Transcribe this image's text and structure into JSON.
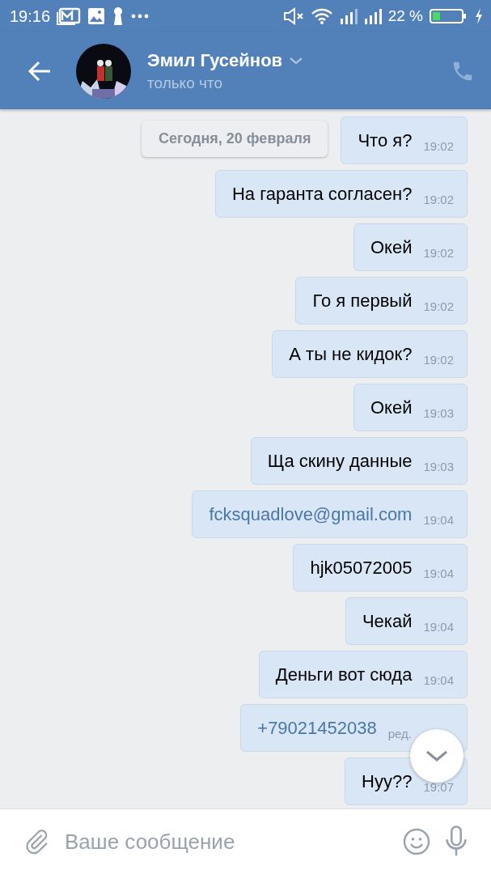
{
  "status_bar": {
    "time": "19:16",
    "battery": "22 %"
  },
  "header": {
    "name": "Эмил Гусейнов",
    "status": "только что"
  },
  "date_divider": "Сегодня, 20 февраля",
  "messages": [
    {
      "kind": "text",
      "text": "Что я?",
      "time": "19:02"
    },
    {
      "kind": "text",
      "text": "На гаранта согласен?",
      "time": "19:02"
    },
    {
      "kind": "text",
      "text": "Окей",
      "time": "19:02"
    },
    {
      "kind": "text",
      "text": "Го я первый",
      "time": "19:02"
    },
    {
      "kind": "text",
      "text": "А ты не кидок?",
      "time": "19:02"
    },
    {
      "kind": "text",
      "text": "Окей",
      "time": "19:03"
    },
    {
      "kind": "text",
      "text": "Ща скину данные",
      "time": "19:03"
    },
    {
      "kind": "link",
      "text": "fcksquadlove@gmail.com",
      "time": "19:04"
    },
    {
      "kind": "text",
      "text": "hjk05072005",
      "time": "19:04"
    },
    {
      "kind": "text",
      "text": "Чекай",
      "time": "19:04"
    },
    {
      "kind": "text",
      "text": "Деньги вот сюда",
      "time": "19:04"
    },
    {
      "kind": "link",
      "text": "+79021452038",
      "edited_label": "ред."
    },
    {
      "kind": "text",
      "text": "Нуу??",
      "time": "19:07"
    }
  ],
  "composer": {
    "placeholder": "Ваше сообщение"
  }
}
